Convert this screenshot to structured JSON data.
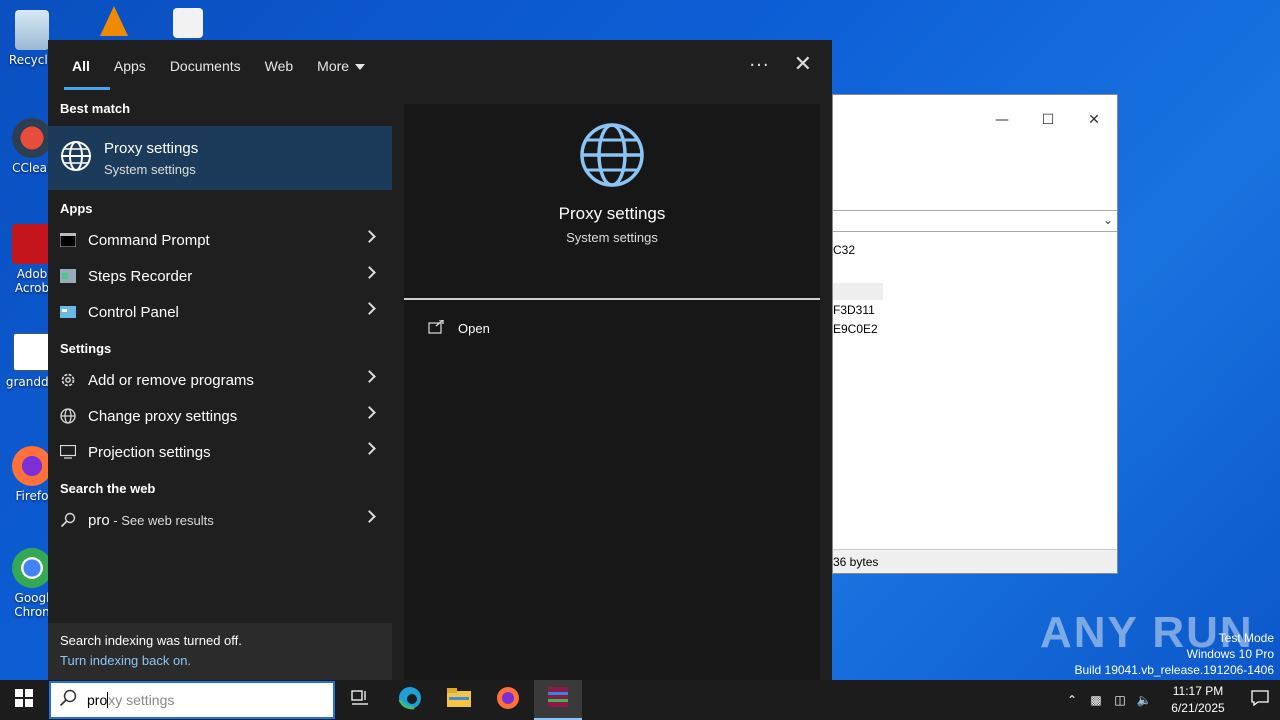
{
  "desktop": {
    "icons": [
      {
        "label": "Recycle"
      },
      {
        "label": "CClear"
      },
      {
        "label": "Adob Acrob"
      },
      {
        "label": "granddis"
      },
      {
        "label": "Firefo"
      },
      {
        "label": "Googl Chron"
      }
    ]
  },
  "bg_window": {
    "lines": [
      "C32",
      "F3D311",
      "E9C0E2"
    ],
    "status": "36 bytes"
  },
  "search_panel": {
    "tabs": [
      "All",
      "Apps",
      "Documents",
      "Web",
      "More"
    ],
    "active_tab": "All",
    "best_match_header": "Best match",
    "best_match": {
      "title": "Proxy settings",
      "subtitle": "System settings"
    },
    "apps_header": "Apps",
    "apps": [
      {
        "label": "Command Prompt",
        "icon": "command-prompt-icon"
      },
      {
        "label": "Steps Recorder",
        "icon": "steps-recorder-icon"
      },
      {
        "label": "Control Panel",
        "icon": "control-panel-icon"
      }
    ],
    "settings_header": "Settings",
    "settings": [
      {
        "label": "Add or remove programs",
        "icon": "gear-icon"
      },
      {
        "label": "Change proxy settings",
        "icon": "globe-icon"
      },
      {
        "label": "Projection settings",
        "icon": "projection-icon"
      }
    ],
    "web_header": "Search the web",
    "web_query": "pro",
    "web_suffix": " - See web results",
    "notice_line1": "Search indexing was turned off.",
    "notice_line2": "Turn indexing back on.",
    "preview": {
      "title": "Proxy settings",
      "subtitle": "System settings",
      "open_label": "Open"
    }
  },
  "taskbar": {
    "search_typed": "pro",
    "search_ghost": "xy settings",
    "clock_time": "11:17 PM",
    "clock_date": "6/21/2025"
  },
  "watermark": {
    "brand": "ANY RUN",
    "line1": "Test Mode",
    "line2": "Windows 10 Pro",
    "line3": "Build 19041.vb_release.191206-1406"
  },
  "colors": {
    "accent": "#4ba3f0",
    "panel_bg": "#1f1f1f",
    "highlight": "#1c3b5a",
    "desktop": "#0d5fd6"
  }
}
